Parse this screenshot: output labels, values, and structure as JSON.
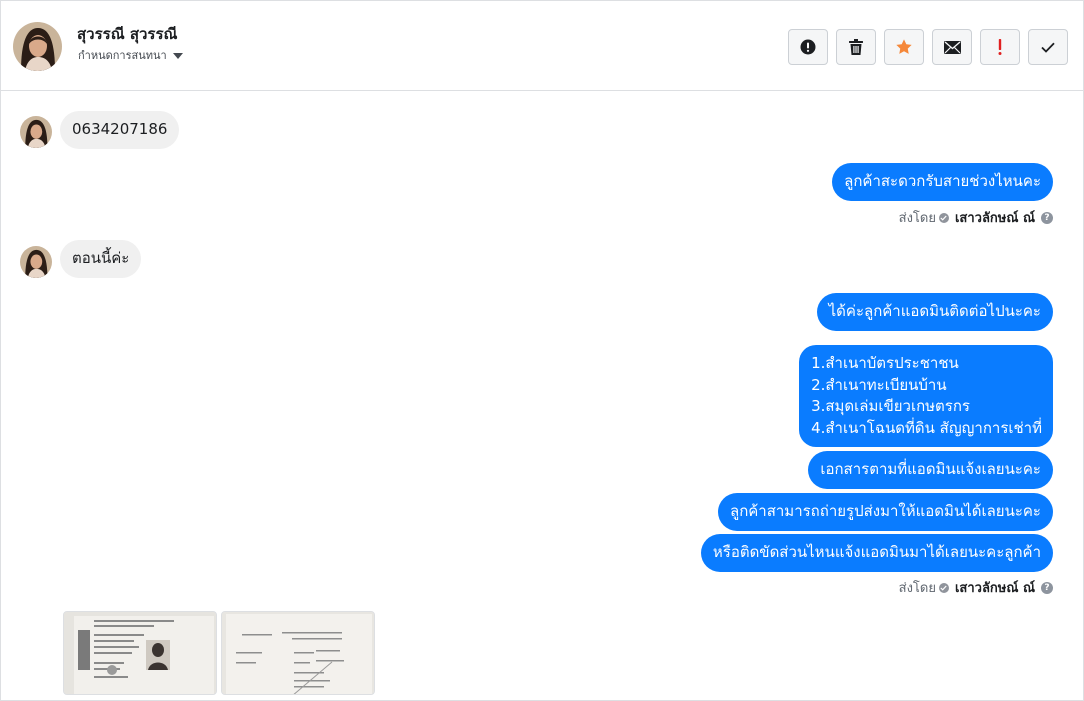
{
  "contact": {
    "name": "สุวรรณี สุวรรณี",
    "subtitle": "กำหนดการสนทนา"
  },
  "toolbar": [
    {
      "icon": "alert-circle-icon",
      "color": "#1c1e21"
    },
    {
      "icon": "trash-icon",
      "color": "#1c1e21"
    },
    {
      "icon": "star-icon",
      "color": "#f5883a"
    },
    {
      "icon": "envelope-icon",
      "color": "#1c1e21"
    },
    {
      "icon": "exclamation-icon",
      "color": "#e02020"
    },
    {
      "icon": "checkmark-icon",
      "color": "#1c1e21"
    }
  ],
  "messages": {
    "in_1": "0634207186",
    "out_1": "ลูกค้าสะดวกรับสายช่วงไหนคะ",
    "in_2": "ตอนนี้ค่ะ",
    "out_2": "ได้ค่ะลูกค้าแอดมินติดต่อไปนะคะ",
    "out_3_lines": [
      "1.สำเนาบัตรประชาชน",
      "2.สำเนาทะเบียนบ้าน",
      "3.สมุดเล่มเขียวเกษตรกร",
      "4.สำเนาโฉนดที่ดิน สัญญาการเช่าที่"
    ],
    "out_4": "เอกสารตามที่แอดมินแจ้งเลยนะคะ",
    "out_5": "ลูกค้าสามารถถ่ายรูปส่งมาให้แอดมินได้เลยนะคะ",
    "out_6": "หรือติดขัดส่วนไหนแจ้งแอดมินมาได้เลยนะคะลูกค้า"
  },
  "sent_by": {
    "prefix": "ส่งโดย",
    "sender": "เสาวลักษณ์ ณ์",
    "help": "?"
  },
  "colors": {
    "outgoing_bubble": "#0a7cff",
    "incoming_bubble": "#f0f0f0"
  }
}
